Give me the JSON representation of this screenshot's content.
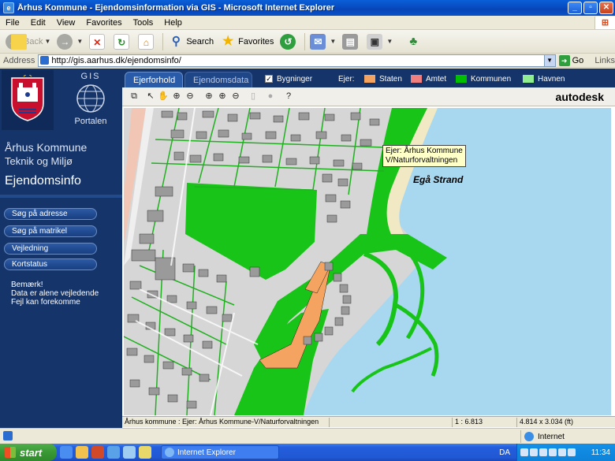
{
  "window": {
    "title": "Århus Kommune - Ejendomsinformation via GIS - Microsoft Internet Explorer"
  },
  "menu": [
    "File",
    "Edit",
    "View",
    "Favorites",
    "Tools",
    "Help"
  ],
  "toolbar": {
    "back": "Back",
    "search": "Search",
    "favorites": "Favorites"
  },
  "address": {
    "label": "Address",
    "url": "http://gis.aarhus.dk/ejendomsinfo/",
    "go": "Go",
    "links": "Links"
  },
  "left_panel": {
    "gis": "GIS",
    "portal": "Portalen",
    "org": "Århus Kommune",
    "dept": "Teknik og Miljø",
    "heading": "Ejendomsinfo",
    "nav": [
      "Søg på adresse",
      "Søg på matrikel",
      "Vejledning",
      "Kortstatus"
    ],
    "notes": [
      "Bemærk!",
      "Data er alene vejledende",
      "Fejl kan forekomme"
    ]
  },
  "tabs": {
    "active": "Ejerforhold",
    "inactive": "Ejendomsdata"
  },
  "legend": {
    "buildings_label": "Bygninger",
    "buildings_checked": "✓",
    "owner_label": "Ejer:",
    "items": [
      {
        "label": "Staten",
        "color": "#f4a460"
      },
      {
        "label": "Amtet",
        "color": "#f08080"
      },
      {
        "label": "Kommunen",
        "color": "#00c000"
      },
      {
        "label": "Havnen",
        "color": "#90ee90"
      }
    ]
  },
  "map_tools": {
    "brand": "autodesk"
  },
  "map": {
    "tooltip_line1": "Ejer: Århus Kommune",
    "tooltip_line2": "V/Naturforvaltningen",
    "place_label": "Egå Strand",
    "colors": {
      "sea": "#a8d8f0",
      "municipal": "#18c418",
      "state": "#f4a460",
      "land": "#d6d6d6"
    }
  },
  "map_status": {
    "owner": "Århus kommune : Ejer: Århus Kommune-V/Naturforvaltningen",
    "scale": "1 : 6.813",
    "size": "4.814 x 3.034 (ft)"
  },
  "statusbar": {
    "zone": "Internet"
  },
  "taskbar": {
    "start": "start",
    "task": "Internet Explorer",
    "lang": "DA",
    "clock": "11:34"
  }
}
